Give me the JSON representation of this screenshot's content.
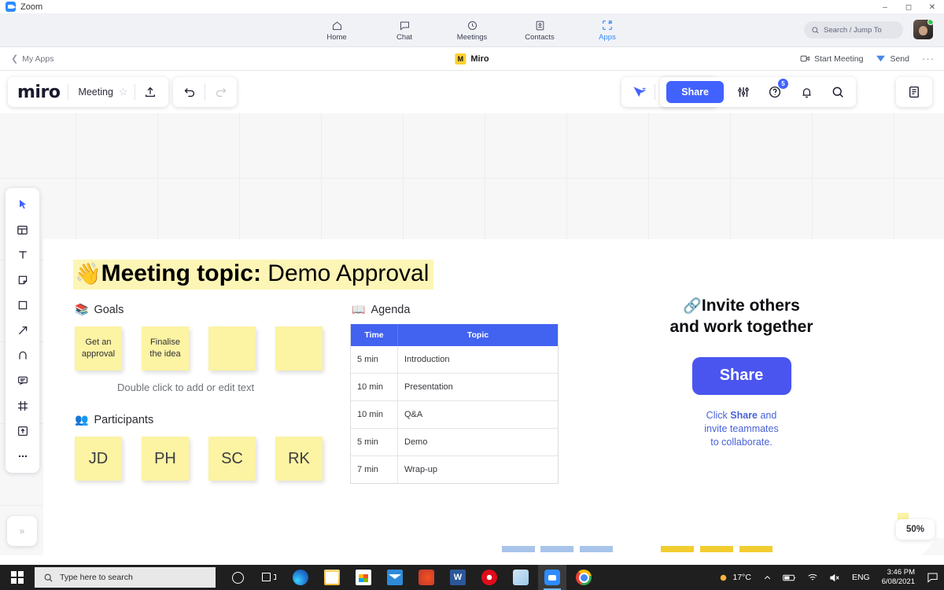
{
  "zoom_window": {
    "title": "Zoom",
    "window_controls": [
      "minimize",
      "maximize",
      "close"
    ],
    "nav": [
      {
        "label": "Home",
        "icon": "home-icon",
        "active": false
      },
      {
        "label": "Chat",
        "icon": "chat-bubble-icon",
        "active": false
      },
      {
        "label": "Meetings",
        "icon": "clock-icon",
        "active": false
      },
      {
        "label": "Contacts",
        "icon": "contact-card-icon",
        "active": false
      },
      {
        "label": "Apps",
        "icon": "apps-icon",
        "active": true
      }
    ],
    "search_placeholder": "Search / Jump To",
    "accent": "#2d8cff"
  },
  "app_subbar": {
    "back_label": "My Apps",
    "app_name": "Miro",
    "start_meeting_label": "Start Meeting",
    "send_label": "Send",
    "more_label": "···"
  },
  "miro_toolbar": {
    "wordmark": "miro",
    "board_name": "Meeting",
    "star_icon": "star-icon",
    "upload_icon": "upload-icon",
    "undo_icon": "undo-icon",
    "redo_icon": "redo-icon",
    "cursor_share_icon": "cursor-share-icon",
    "fire_icon": "fire-reaction-icon",
    "avatar_icon": "user-avatar-icon",
    "share_label": "Share",
    "settings_icon": "sliders-icon",
    "help_icon": "help-circle-icon",
    "help_badge": "5",
    "notifications_icon": "bell-icon",
    "search_icon": "search-icon",
    "notes_panel_icon": "notes-panel-icon",
    "share_color": "#4262ff"
  },
  "tool_rail": [
    {
      "name": "cursor-tool",
      "active": true
    },
    {
      "name": "templates-tool",
      "active": false
    },
    {
      "name": "text-tool",
      "active": false
    },
    {
      "name": "sticky-note-tool",
      "active": false
    },
    {
      "name": "shapes-tool",
      "active": false
    },
    {
      "name": "arrow-tool",
      "active": false
    },
    {
      "name": "pen-tool",
      "active": false
    },
    {
      "name": "comment-tool",
      "active": false
    },
    {
      "name": "frame-tool",
      "active": false
    },
    {
      "name": "upload-tool",
      "active": false
    },
    {
      "name": "more-tools",
      "active": false
    }
  ],
  "board": {
    "topic": {
      "emoji": "👋",
      "label": "Meeting topic:",
      "value": "Demo Approval",
      "highlight_color": "#fdf5b5"
    },
    "goals": {
      "emoji": "📚",
      "heading": "Goals",
      "notes": [
        "Get an approval",
        "Finalise the idea",
        "",
        ""
      ],
      "hint": "Double click to add or edit text",
      "note_color": "#fcf3a3"
    },
    "participants": {
      "emoji": "👥",
      "heading": "Participants",
      "notes": [
        "JD",
        "PH",
        "SC",
        "RK"
      ]
    },
    "agenda": {
      "emoji": "📖",
      "heading": "Agenda",
      "columns": [
        "Time",
        "Topic"
      ],
      "header_color": "#4262f0",
      "rows": [
        {
          "time": "5 min",
          "topic": "Introduction"
        },
        {
          "time": "10 min",
          "topic": "Presentation"
        },
        {
          "time": "10 min",
          "topic": "Q&A"
        },
        {
          "time": "5 min",
          "topic": "Demo"
        },
        {
          "time": "7 min",
          "topic": "Wrap-up"
        }
      ]
    },
    "invite": {
      "emoji": "🔗",
      "title_line1": "Invite others",
      "title_line2": "and work together",
      "button_label": "Share",
      "sub_prefix": "Click ",
      "sub_bold": "Share",
      "sub_suffix": " and",
      "sub_line2": "invite teammates",
      "sub_line3": "to collaborate.",
      "link_color": "#4a63d8"
    },
    "zoom_level": "50%",
    "collapse_icon": "chevron-double-right-icon"
  },
  "taskbar": {
    "start_icon": "windows-start-icon",
    "search_placeholder": "Type here to search",
    "cortana_icon": "cortana-icon",
    "taskview_icon": "task-view-icon",
    "apps": [
      {
        "name": "edge-icon"
      },
      {
        "name": "file-explorer-icon"
      },
      {
        "name": "microsoft-store-icon"
      },
      {
        "name": "mail-icon"
      },
      {
        "name": "office-icon"
      },
      {
        "name": "word-icon"
      },
      {
        "name": "opera-icon"
      },
      {
        "name": "store-app-icon"
      },
      {
        "name": "zoom-icon",
        "active": true
      },
      {
        "name": "chrome-icon"
      }
    ],
    "tray": {
      "temperature": "17°C",
      "show_hidden_icon": "chevron-up-icon",
      "battery_icon": "battery-icon",
      "wifi_icon": "wifi-icon",
      "volume_icon": "volume-muted-icon",
      "language": "ENG",
      "time": "3:46 PM",
      "date": "6/08/2021",
      "action_center_icon": "action-center-icon"
    }
  }
}
